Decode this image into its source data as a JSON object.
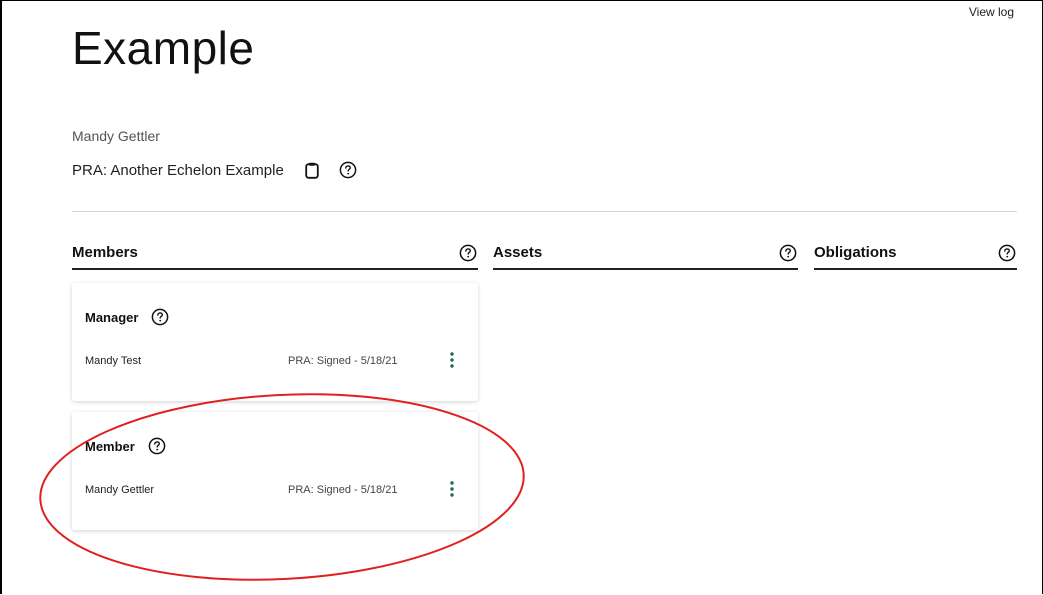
{
  "header": {
    "view_log": "View log",
    "title": "Example"
  },
  "person": {
    "name": "Mandy Gettler"
  },
  "pra": {
    "label": "PRA: Another Echelon Example",
    "copy_icon": "clipboard-icon",
    "help_icon": "help-circle-icon"
  },
  "sections": {
    "members": "Members",
    "assets": "Assets",
    "obligations": "Obligations"
  },
  "cards": [
    {
      "role": "Manager",
      "name": "Mandy Test",
      "status": "PRA: Signed - 5/18/21"
    },
    {
      "role": "Member",
      "name": "Mandy Gettler",
      "status": "PRA: Signed - 5/18/21"
    }
  ],
  "colors": {
    "accent": "#1e6b43",
    "annotation": "#e02020",
    "text": "#1a1a1a",
    "divider": "#d6d6d6"
  }
}
